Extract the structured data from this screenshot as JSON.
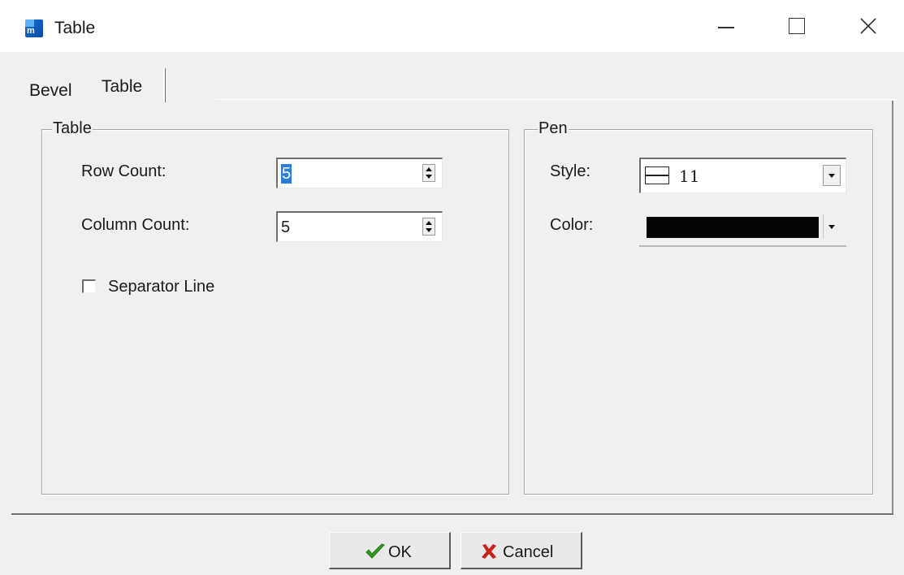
{
  "window": {
    "title": "Table"
  },
  "tabs": [
    {
      "label": "Bevel",
      "active": false
    },
    {
      "label": "Table",
      "active": true
    }
  ],
  "table_group": {
    "title": "Table",
    "row_count_label": "Row Count:",
    "row_count_value": "5",
    "column_count_label": "Column Count:",
    "column_count_value": "5",
    "separator_line_label": "Separator Line",
    "separator_line_checked": false
  },
  "pen_group": {
    "title": "Pen",
    "style_label": "Style:",
    "style_value": "11",
    "color_label": "Color:",
    "color_value": "#050505"
  },
  "buttons": {
    "ok_label": "OK",
    "cancel_label": "Cancel"
  },
  "colors": {
    "selection": "#2c7fd6",
    "ok_check": "#2e9e1e",
    "cancel_x": "#c8201a"
  }
}
